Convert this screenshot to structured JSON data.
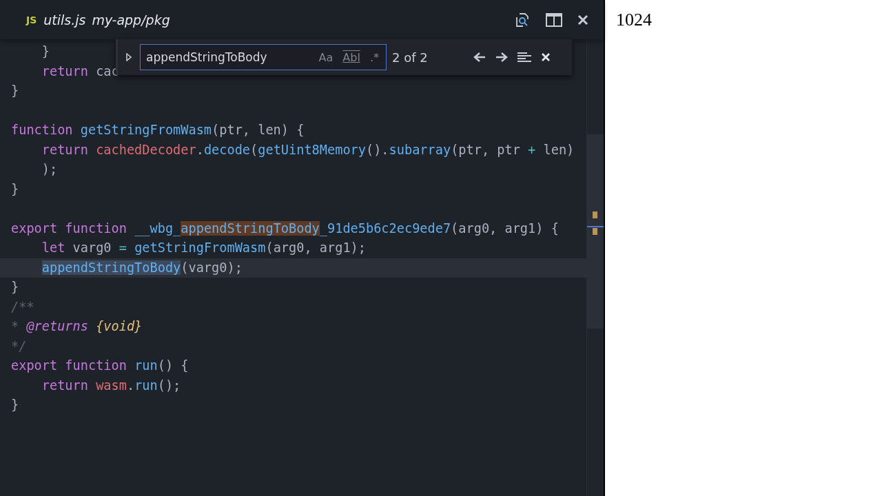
{
  "tab": {
    "badge": "JS",
    "file": "utils.js",
    "path": "my-app/pkg"
  },
  "find": {
    "value": "appendStringToBody",
    "options": [
      {
        "label": "Aa",
        "on": false
      },
      {
        "label": "Abl",
        "on": false
      },
      {
        "label": ".*",
        "on": false
      }
    ],
    "count": "2 of 2"
  },
  "code": [
    {
      "current": false,
      "tokens": [
        {
          "kind": "plain",
          "text": "    }"
        }
      ]
    },
    {
      "current": false,
      "tokens": [
        {
          "kind": "kw",
          "text": "    return"
        },
        {
          "kind": "plain",
          "text": " cac"
        }
      ]
    },
    {
      "current": false,
      "tokens": [
        {
          "kind": "plain",
          "text": "}"
        }
      ]
    },
    {
      "current": false
    },
    {
      "current": false,
      "tokens": [
        {
          "kind": "kw",
          "text": "function "
        },
        {
          "kind": "fn",
          "text": "getStringFromWasm"
        },
        {
          "kind": "plain",
          "text": "(ptr, len) {"
        }
      ]
    },
    {
      "current": false,
      "tokens": [
        {
          "kind": "kw",
          "text": "    return "
        },
        {
          "kind": "var",
          "text": "cachedDecoder"
        },
        {
          "kind": "plain",
          "text": "."
        },
        {
          "kind": "fn",
          "text": "decode"
        },
        {
          "kind": "plain",
          "text": "("
        },
        {
          "kind": "fn",
          "text": "getUint8Memory"
        },
        {
          "kind": "plain",
          "text": "()."
        },
        {
          "kind": "fn",
          "text": "subarray"
        },
        {
          "kind": "plain",
          "text": "(ptr, ptr "
        },
        {
          "kind": "op",
          "text": "+"
        },
        {
          "kind": "plain",
          "text": " len)"
        }
      ]
    },
    {
      "current": false,
      "tokens": [
        {
          "kind": "plain",
          "text": "    );"
        }
      ]
    },
    {
      "current": false,
      "tokens": [
        {
          "kind": "plain",
          "text": "}"
        }
      ]
    },
    {
      "current": false
    },
    {
      "current": false,
      "tokens": [
        {
          "kind": "kw",
          "text": "export function "
        },
        {
          "kind": "fn",
          "text": "__wbg_"
        },
        {
          "kind": "fn",
          "text": "appendStringToBody",
          "found": true
        },
        {
          "kind": "fn",
          "text": "_91de5b6c2ec9ede7"
        },
        {
          "kind": "plain",
          "text": "(arg0, arg1) {"
        }
      ]
    },
    {
      "current": false,
      "tokens": [
        {
          "kind": "kw",
          "text": "    let "
        },
        {
          "kind": "plain",
          "text": "varg0 "
        },
        {
          "kind": "op",
          "text": "="
        },
        {
          "kind": "fn",
          "text": " getStringFromWasm"
        },
        {
          "kind": "plain",
          "text": "(arg0, arg1);"
        }
      ]
    },
    {
      "current": true,
      "tokens": [
        {
          "kind": "fn",
          "text": "    appendStringToBody",
          "selected": true
        },
        {
          "kind": "plain",
          "text": "(varg0);"
        }
      ]
    },
    {
      "current": false,
      "tokens": [
        {
          "kind": "plain",
          "text": "}"
        }
      ]
    },
    {
      "current": false,
      "tokens": [
        {
          "kind": "comment",
          "text": "/**"
        }
      ]
    },
    {
      "current": false,
      "tokens": [
        {
          "kind": "comment",
          "text": "* "
        },
        {
          "kind": "tag",
          "text": "@returns "
        },
        {
          "kind": "type",
          "text": "{void}"
        }
      ]
    },
    {
      "current": false,
      "tokens": [
        {
          "kind": "comment",
          "text": "*/"
        }
      ]
    },
    {
      "current": false,
      "tokens": [
        {
          "kind": "kw",
          "text": "export function "
        },
        {
          "kind": "fn",
          "text": "run"
        },
        {
          "kind": "plain",
          "text": "() {"
        }
      ]
    },
    {
      "current": false,
      "tokens": [
        {
          "kind": "kw",
          "text": "    return "
        },
        {
          "kind": "var",
          "text": "wasm"
        },
        {
          "kind": "plain",
          "text": "."
        },
        {
          "kind": "fn",
          "text": "run"
        },
        {
          "kind": "plain",
          "text": "();"
        }
      ]
    },
    {
      "current": false,
      "tokens": [
        {
          "kind": "plain",
          "text": "}"
        }
      ]
    }
  ],
  "output": {
    "text": "1024"
  }
}
